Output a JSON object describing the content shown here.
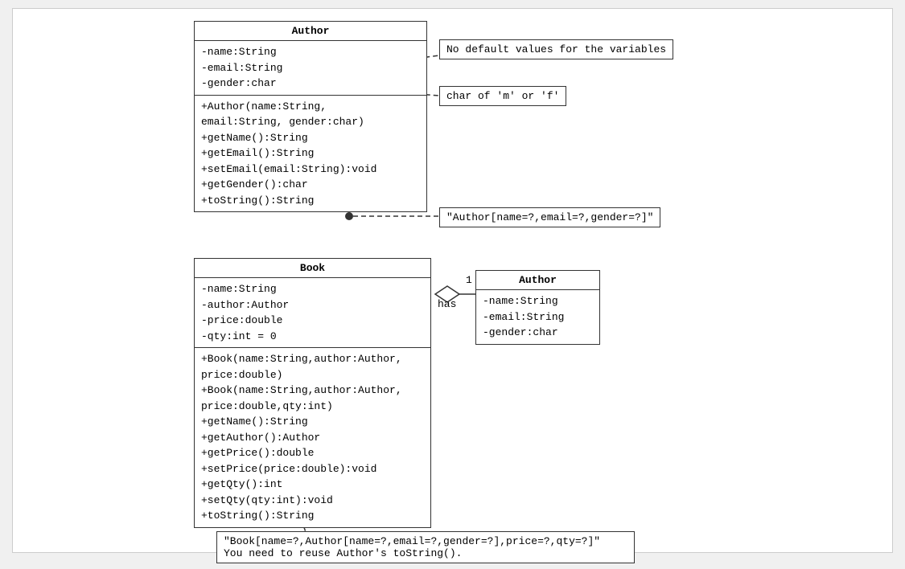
{
  "author_class": {
    "title": "Author",
    "attributes": [
      "-name:String",
      "-email:String",
      "-gender:char"
    ],
    "methods": [
      "+Author(name:String,",
      "   email:String, gender:char)",
      "+getName():String",
      "+getEmail():String",
      "+setEmail(email:String):void",
      "+getGender():char",
      "+toString():String"
    ]
  },
  "book_class": {
    "title": "Book",
    "attributes": [
      "-name:String",
      "-author:Author",
      "-price:double",
      "-qty:int = 0"
    ],
    "methods": [
      "+Book(name:String,author:Author,",
      "   price:double)",
      "+Book(name:String,author:Author,",
      "   price:double,qty:int)",
      "+getName():String",
      "+getAuthor():Author",
      "+getPrice():double",
      "+setPrice(price:double):void",
      "+getQty():int",
      "+setQty(qty:int):void",
      "+toString():String"
    ]
  },
  "author_ref_class": {
    "title": "Author",
    "attributes": [
      "-name:String",
      "-email:String",
      "-gender:char"
    ]
  },
  "notes": {
    "no_default": "No default values for the variables",
    "char_of": "char of 'm' or 'f'",
    "to_string_author": "\"Author[name=?,email=?,gender=?]\"",
    "to_string_book": "\"Book[name=?,Author[name=?,email=?,gender=?],price=?,qty=?]\"",
    "reuse_note": "You need to reuse Author's toString()."
  },
  "relationship": {
    "label": "has",
    "multiplicity": "1"
  }
}
